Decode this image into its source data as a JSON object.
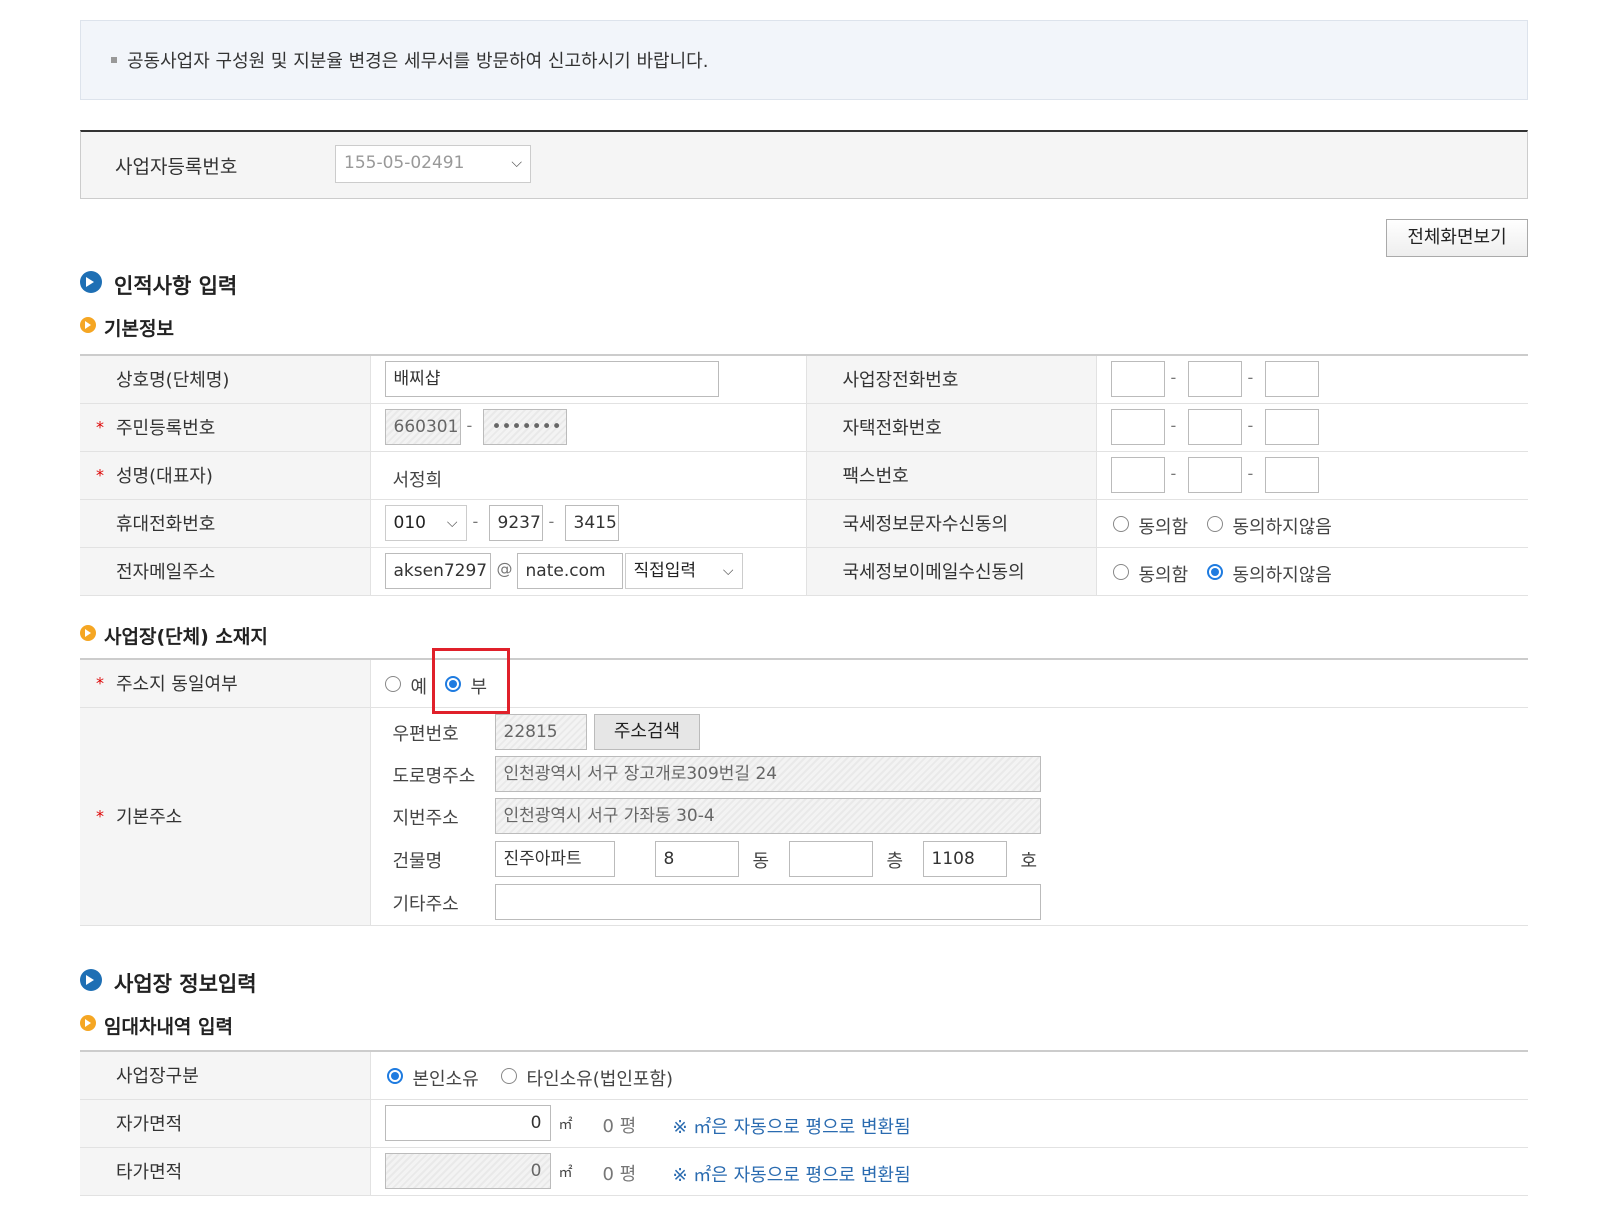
{
  "notice": {
    "text": "공동사업자 구성원 및 지분율 변경은 세무서를 방문하여 신고하시기 바랍니다."
  },
  "registration": {
    "label": "사업자등록번호",
    "selected": "155-05-02491"
  },
  "buttons": {
    "fullscreen": "전체화면보기",
    "address_search": "주소검색"
  },
  "section_personal": {
    "title": "인적사항 입력",
    "subtitle": "기본정보",
    "rows": {
      "company_name_label": "상호명(단체명)",
      "company_name_value": "배찌샵",
      "resident_no_label": "주민등록번호",
      "resident_no_front": "660301",
      "resident_no_back": "•••••••",
      "name_label": "성명(대표자)",
      "name_value": "서정희",
      "mobile_label": "휴대전화번호",
      "mobile_prefix": "010",
      "mobile_mid": "9237",
      "mobile_last": "3415",
      "email_label": "전자메일주소",
      "email_id": "aksen7297",
      "email_at": "@",
      "email_domain": "nate.com",
      "email_select": "직접입력",
      "biz_phone_label": "사업장전화번호",
      "home_phone_label": "자택전화번호",
      "fax_label": "팩스번호",
      "sms_consent_label": "국세정보문자수신동의",
      "email_consent_label": "국세정보이메일수신동의",
      "agree": "동의함",
      "disagree": "동의하지않음",
      "sms_consent_value": "none",
      "email_consent_value": "동의하지않음"
    }
  },
  "section_location": {
    "subtitle": "사업장(단체) 소재지",
    "same_address_label": "주소지 동일여부",
    "yes": "예",
    "no": "부",
    "same_address_value": "부",
    "basic_address_label": "기본주소",
    "zip_label": "우편번호",
    "zip_value": "22815",
    "road_label": "도로명주소",
    "road_value": "인천광역시 서구 장고개로309번길 24",
    "lot_label": "지번주소",
    "lot_value": "인천광역시 서구 가좌동 30-4",
    "building_label": "건물명",
    "building_value": "진주아파트",
    "dong_value": "8",
    "dong_unit": "동",
    "floor_value": "",
    "floor_unit": "층",
    "ho_value": "1108",
    "ho_unit": "호",
    "etc_label": "기타주소",
    "etc_value": ""
  },
  "section_business": {
    "title": "사업장 정보입력",
    "subtitle": "임대차내역 입력",
    "type_label": "사업장구분",
    "own": "본인소유",
    "other": "타인소유(법인포함)",
    "type_value": "본인소유",
    "own_area_label": "자가면적",
    "own_area_value": "0",
    "other_area_label": "타가면적",
    "other_area_value": "0",
    "sqm_unit": "㎡",
    "pyeong": "0 평",
    "convert_note": "※ ㎡은 자동으로 평으로 변환됨"
  },
  "colors": {
    "accent": "#1e7be0",
    "highlight": "#e0202a",
    "note": "#2a6bb0"
  }
}
